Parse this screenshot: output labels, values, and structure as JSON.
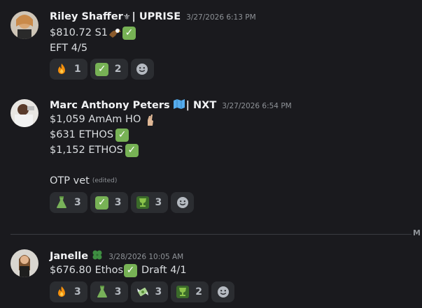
{
  "messages": [
    {
      "username": "Riley Shaffer",
      "tag": "| UPRISE",
      "timestamp": "3/27/2026 6:13 PM",
      "lines": [
        {
          "text": "$810.72 S1"
        },
        {
          "text": "EFT 4/5"
        }
      ],
      "reactions": [
        {
          "emoji": "fire-icon",
          "count": "1"
        },
        {
          "emoji": "check-icon",
          "count": "2"
        }
      ]
    },
    {
      "username": "Marc Anthony Peters",
      "tag": "| NXT",
      "timestamp": "3/27/2026 6:54 PM",
      "lines": [
        {
          "text": "$1,059 AmAm HO"
        },
        {
          "text": "$631 ETHOS"
        },
        {
          "text": "$1,152 ETHOS"
        },
        {
          "text": "OTP vet",
          "edited": "(edited)"
        }
      ],
      "reactions": [
        {
          "emoji": "flask-icon",
          "count": "3"
        },
        {
          "emoji": "check-icon",
          "count": "3"
        },
        {
          "emoji": "trophy-icon",
          "count": "3"
        }
      ]
    },
    {
      "username": "Janelle",
      "tag": "",
      "timestamp": "3/28/2026 10:05 AM",
      "lines": [
        {
          "text": "$676.80 Ethos",
          "suffix": "Draft 4/1"
        }
      ],
      "reactions": [
        {
          "emoji": "fire-icon",
          "count": "3"
        },
        {
          "emoji": "flask-icon",
          "count": "3"
        },
        {
          "emoji": "money-wings-icon",
          "count": "3"
        },
        {
          "emoji": "trophy-icon",
          "count": "2"
        }
      ]
    }
  ],
  "divider": {
    "label": "M"
  },
  "colors": {
    "background": "#1a1a1e",
    "reaction_bg": "#2b2d31",
    "check_green": "#77b255",
    "text": "#dbdee1",
    "muted": "#8e9297"
  }
}
